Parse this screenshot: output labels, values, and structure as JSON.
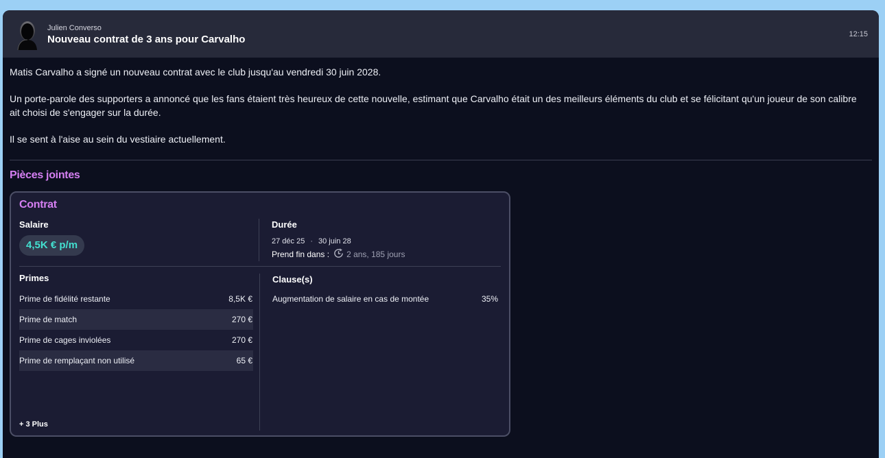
{
  "message": {
    "sender": "Julien Converso",
    "subject": "Nouveau contrat de 3 ans pour Carvalho",
    "time": "12:15",
    "paragraphs": [
      "Matis Carvalho a signé un nouveau contrat avec le club jusqu'au vendredi 30 juin 2028.",
      "Un porte-parole des supporters a annoncé que les fans étaient très heureux de cette nouvelle, estimant que Carvalho était un des meilleurs éléments du club et se félicitant qu'un joueur de son calibre ait choisi de s'engager sur la durée.",
      "Il se sent à l'aise au sein du vestiaire actuellement."
    ]
  },
  "attachments": {
    "title": "Pièces jointes",
    "contract": {
      "title": "Contrat",
      "salary_label": "Salaire",
      "salary_value": "4,5K € p/m",
      "duration_label": "Durée",
      "start_date": "27 déc 25",
      "date_separator": "·",
      "end_date": "30 juin 28",
      "ends_in_label": "Prend fin dans :",
      "remaining": "2 ans, 185 jours",
      "bonuses_label": "Primes",
      "bonuses": [
        {
          "name": "Prime de fidélité restante",
          "value": "8,5K €"
        },
        {
          "name": "Prime de match",
          "value": "270 €"
        },
        {
          "name": "Prime de cages inviolées",
          "value": "270 €"
        },
        {
          "name": "Prime de remplaçant non utilisé",
          "value": "65 €"
        }
      ],
      "more_label": "+ 3 Plus",
      "clauses_label": "Clause(s)",
      "clauses": [
        {
          "name": "Augmentation de salaire en cas de montée",
          "value": "35%"
        }
      ]
    }
  },
  "colors": {
    "accent_purple": "#d57ff2",
    "salary_teal": "#43e0d0",
    "background": "#0c0f1e",
    "header": "#272a3a"
  }
}
